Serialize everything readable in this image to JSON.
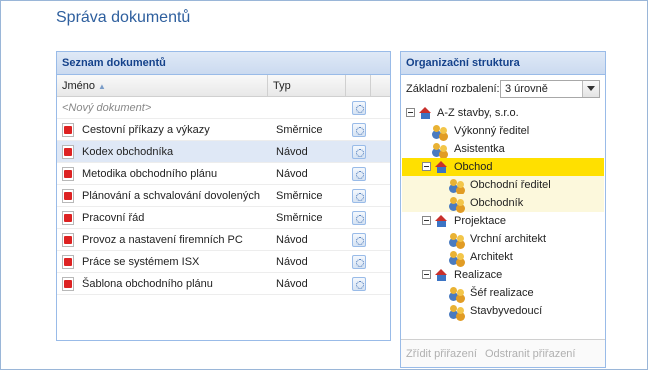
{
  "page": {
    "title": "Správa dokumentů"
  },
  "documents": {
    "panel_title": "Seznam dokumentů",
    "columns": {
      "name": "Jméno",
      "type": "Typ"
    },
    "new_placeholder": "<Nový dokument>",
    "rows": [
      {
        "name": "Cestovní příkazy a výkazy",
        "type": "Směrnice"
      },
      {
        "name": "Kodex obchodníka",
        "type": "Návod"
      },
      {
        "name": "Metodika obchodního plánu",
        "type": "Návod"
      },
      {
        "name": "Plánování a schvalování dovolených",
        "type": "Směrnice"
      },
      {
        "name": "Pracovní řád",
        "type": "Směrnice"
      },
      {
        "name": "Provoz a nastavení firemních PC",
        "type": "Návod"
      },
      {
        "name": "Práce se systémem ISX",
        "type": "Návod"
      },
      {
        "name": "Šablona obchodního plánu",
        "type": "Návod"
      }
    ]
  },
  "org": {
    "panel_title": "Organizační struktura",
    "expand_label": "Základní rozbalení:",
    "expand_value": "3 úrovně",
    "tree": {
      "root": "A-Z stavby, s.r.o.",
      "n1": "Výkonný ředitel",
      "n2": "Asistentka",
      "n3": "Obchod",
      "n3a": "Obchodní ředitel",
      "n3b": "Obchodník",
      "n4": "Projektace",
      "n4a": "Vrchní architekt",
      "n4b": "Architekt",
      "n5": "Realizace",
      "n5a": "Šéf realizace",
      "n5b": "Stavbyvedoucí"
    },
    "footer": {
      "create_label": "Zřídit přiřazení",
      "remove_label": "Odstranit přiřazení"
    }
  }
}
